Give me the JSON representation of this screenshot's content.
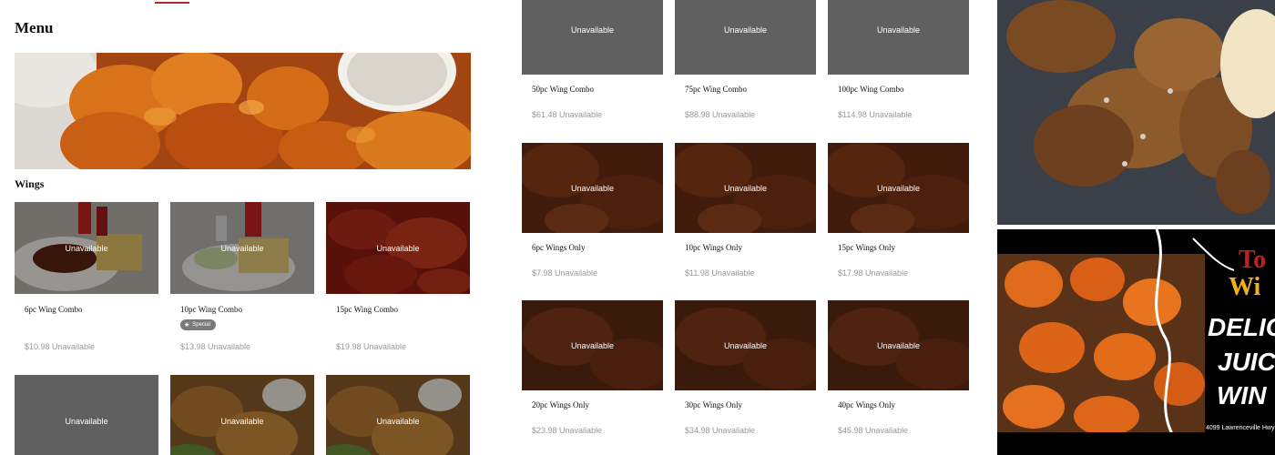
{
  "menu": {
    "title": "Menu"
  },
  "section": {
    "title": "Wings"
  },
  "unavailable_label": "Unavailable",
  "items_left": [
    {
      "name": "6pc Wing Combo",
      "price": "$10.98 Unavailable",
      "badge": null
    },
    {
      "name": "10pc Wing Combo",
      "price": "$13.98 Unavailable",
      "badge": "Special"
    },
    {
      "name": "15pc Wing Combo",
      "price": "$19.98 Unavailable",
      "badge": null
    }
  ],
  "items_left_row2": [
    {
      "overlay": "Unavailable"
    },
    {
      "overlay": "Unavailable"
    },
    {
      "overlay": "Unavailable"
    }
  ],
  "items_mid": [
    {
      "name": "50pc Wing Combo",
      "price": "$61.48 Unavailable"
    },
    {
      "name": "75pc Wing Combo",
      "price": "$88.98 Unavailable"
    },
    {
      "name": "100pc Wing Combo",
      "price": "$114.98 Unavailable"
    },
    {
      "name": "6pc Wings Only",
      "price": "$7.98 Unavailable"
    },
    {
      "name": "10pc Wings Only",
      "price": "$11.98 Unavailable"
    },
    {
      "name": "15pc Wings Only",
      "price": "$17.98 Unavailable"
    },
    {
      "name": "20pc Wings Only",
      "price": "$23.98 Unavailable"
    },
    {
      "name": "30pc Wings Only",
      "price": "$34.98 Unavailable"
    },
    {
      "name": "40pc Wings Only",
      "price": "$45.98 Unavailable"
    }
  ],
  "promo": {
    "headline_1": "To",
    "headline_2": "Wi",
    "line_1": "DELICI",
    "line_2": "JUIC",
    "line_3": "WIN",
    "address": "4099 Lawrenceville Hwy"
  },
  "colors": {
    "accent": "#b3262c",
    "overlay_grey": "#606060",
    "price_grey": "#999999",
    "badge_grey": "#7a7a7a"
  }
}
